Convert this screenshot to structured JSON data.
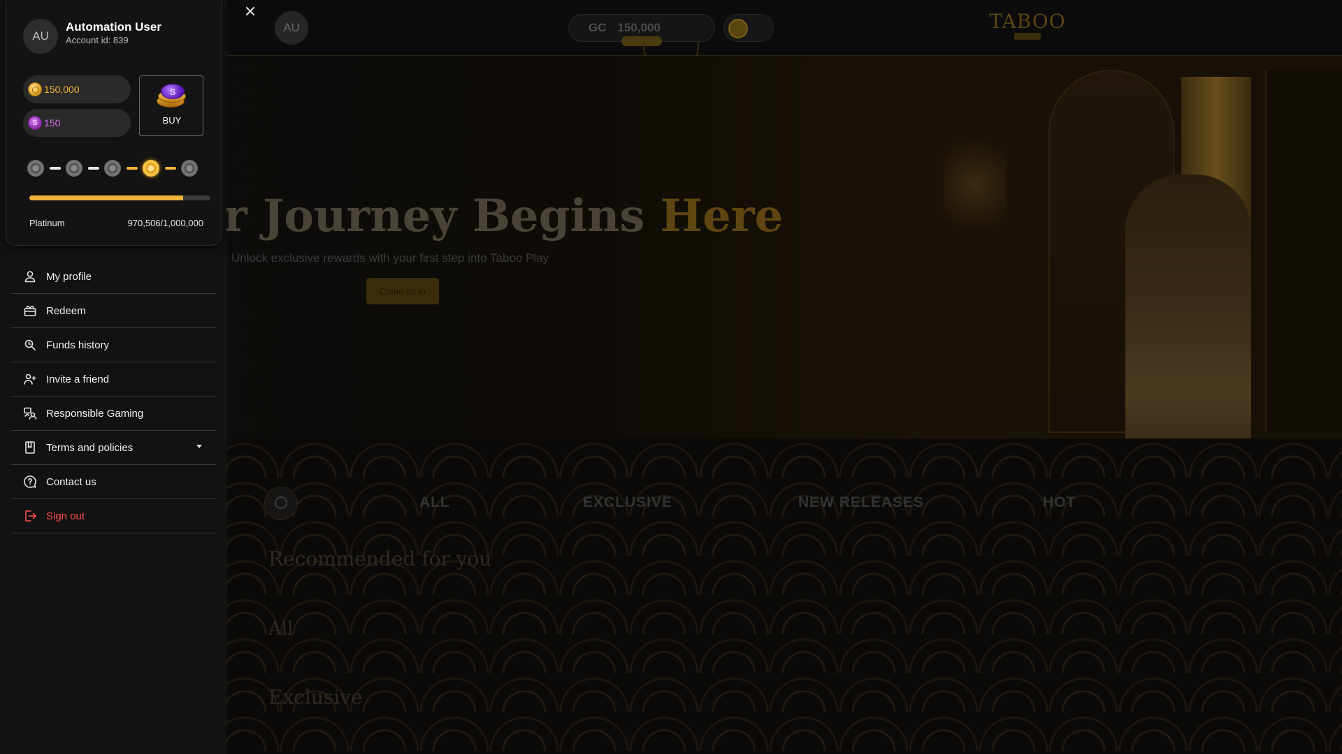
{
  "site": {
    "top_avatar_initials": "AU",
    "gc_pill": {
      "currency": "GC",
      "amount": "150,000"
    },
    "logo": "TABOO",
    "hero": {
      "title_prefix": "r Journey Begins ",
      "title_highlight": "Here",
      "subtitle": "Unlock exclusive rewards with your first step into Taboo Play",
      "cta": "Come on in"
    },
    "tabs": [
      "ALL",
      "EXCLUSIVE",
      "NEW RELEASES",
      "HOT"
    ],
    "sections": [
      "Recommended for you",
      "All",
      "Exclusive"
    ]
  },
  "drawer": {
    "user": {
      "initials": "AU",
      "name": "Automation User",
      "account_id": "Account id: 839"
    },
    "balances": {
      "gc": "150,000",
      "sc": "150",
      "sc_symbol": "S"
    },
    "buy_label": "BUY",
    "buy_coin_symbol": "S",
    "loyalty": {
      "tiers_total": 5,
      "active_tier_index": 3,
      "tier_name": "Platinum",
      "points_text": "970,506/1,000,000",
      "progress_fraction": 0.85
    },
    "menu": [
      {
        "label": "My profile",
        "icon": "user-icon"
      },
      {
        "label": "Redeem",
        "icon": "gift-icon"
      },
      {
        "label": "Funds history",
        "icon": "search-history-icon"
      },
      {
        "label": "Invite a friend",
        "icon": "add-user-icon"
      },
      {
        "label": "Responsible Gaming",
        "icon": "responsible-gaming-icon"
      },
      {
        "label": "Terms and policies",
        "icon": "document-icon",
        "expandable": true
      },
      {
        "label": "Contact us",
        "icon": "help-circle-icon"
      },
      {
        "label": "Sign out",
        "icon": "sign-out-icon"
      }
    ]
  },
  "colors": {
    "accent_gold": "#f0b33c",
    "sc_purple": "#d06ee8",
    "danger": "#ff4d4d"
  }
}
